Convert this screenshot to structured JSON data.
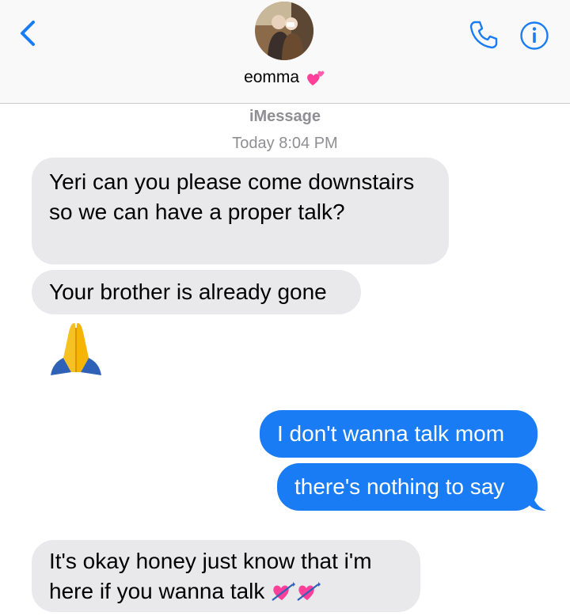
{
  "header": {
    "contact_name": "eomma",
    "back_icon": "chevron-left-icon",
    "phone_icon": "phone-icon",
    "info_icon": "info-icon",
    "name_emoji": "two-hearts-icon"
  },
  "conversation": {
    "service": "iMessage",
    "timestamp": "Today 8:04 PM",
    "messages": [
      {
        "from": "contact",
        "text": "Yeri can you please come downstairs so we can have a proper talk?"
      },
      {
        "from": "contact",
        "text": "Your brother is already gone"
      },
      {
        "from": "contact",
        "emoji": "folded-hands"
      },
      {
        "from": "me",
        "text": "I don't wanna talk mom"
      },
      {
        "from": "me",
        "text": "there's nothing to say"
      },
      {
        "from": "contact",
        "text_line1": "It's okay honey just know that i'm",
        "text_line2": "here if you wanna talk"
      }
    ]
  },
  "colors": {
    "accent": "#1a7cf5",
    "incoming_bubble": "#e9e9eb",
    "meta_text": "#8e8e93"
  }
}
